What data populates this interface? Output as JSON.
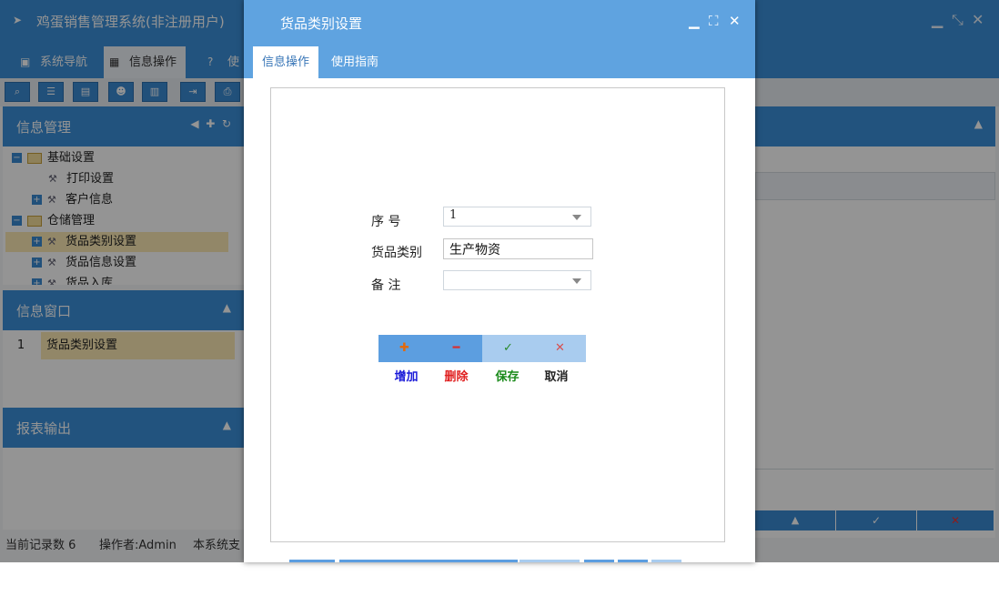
{
  "app": {
    "title": "鸡蛋销售管理系统(非注册用户)",
    "window_controls": [
      "minimize-icon",
      "restore-icon",
      "close-icon"
    ]
  },
  "main_tabs": [
    {
      "label": "系统导航",
      "icon": "monitor-icon"
    },
    {
      "label": "信息操作",
      "icon": "grid-icon",
      "active": true
    },
    {
      "label": "使",
      "icon": "help-icon"
    }
  ],
  "toolbar": {
    "icons": [
      "search-icon",
      "list-icon",
      "document-icon",
      "users-icon",
      "report-icon",
      "export-icon",
      "print-icon"
    ]
  },
  "left": {
    "info_panel": {
      "title": "信息管理",
      "actions": [
        "collapse-left-icon",
        "add-icon",
        "refresh-icon"
      ]
    },
    "tree": [
      {
        "label": "基础设置",
        "level": 0,
        "type": "folder",
        "expand": "−"
      },
      {
        "label": "打印设置",
        "level": 1,
        "type": "leaf"
      },
      {
        "label": "客户信息",
        "level": 1,
        "type": "leaf",
        "expand": "+"
      },
      {
        "label": "仓储管理",
        "level": 0,
        "type": "folder",
        "expand": "−"
      },
      {
        "label": "货品类别设置",
        "level": 1,
        "type": "leaf",
        "expand": "+",
        "selected": true
      },
      {
        "label": "货品信息设置",
        "level": 1,
        "type": "leaf",
        "expand": "+"
      },
      {
        "label": "货品入库",
        "level": 1,
        "type": "leaf",
        "expand": "+"
      }
    ],
    "window_panel": {
      "title": "信息窗口",
      "rows": [
        {
          "num": "1",
          "label": "货品类别设置"
        }
      ]
    },
    "report_panel": {
      "title": "报表输出"
    }
  },
  "status": {
    "records": "当前记录数 6",
    "operator": "操作者:Admin",
    "note": "本系统支"
  },
  "dialog": {
    "title": "货品类别设置",
    "tabs": [
      {
        "label": "信息操作",
        "active": true
      },
      {
        "label": "使用指南"
      }
    ],
    "fields": {
      "seq_label": "序  号",
      "seq_value": "1",
      "category_label": "货品类别",
      "category_value": "生产物资",
      "remark_label": "备  注",
      "remark_value": ""
    },
    "actions": [
      {
        "id": "add",
        "label": "增加",
        "icon": "plus-icon",
        "color": "#1a1ad8",
        "bg": "#5c9ee0"
      },
      {
        "id": "delete",
        "label": "删除",
        "icon": "minus-icon",
        "color": "#e02020",
        "bg": "#5c9ee0"
      },
      {
        "id": "save",
        "label": "保存",
        "icon": "check-icon",
        "color": "#1a8a1a",
        "bg": "#a9ccef"
      },
      {
        "id": "cancel",
        "label": "取消",
        "icon": "x-icon",
        "color": "#222222",
        "bg": "#a9ccef"
      }
    ]
  },
  "colors": {
    "header_blue": "#3b8fd9",
    "dialog_blue": "#5fa3e0",
    "selected_row": "#fbe9b4"
  }
}
